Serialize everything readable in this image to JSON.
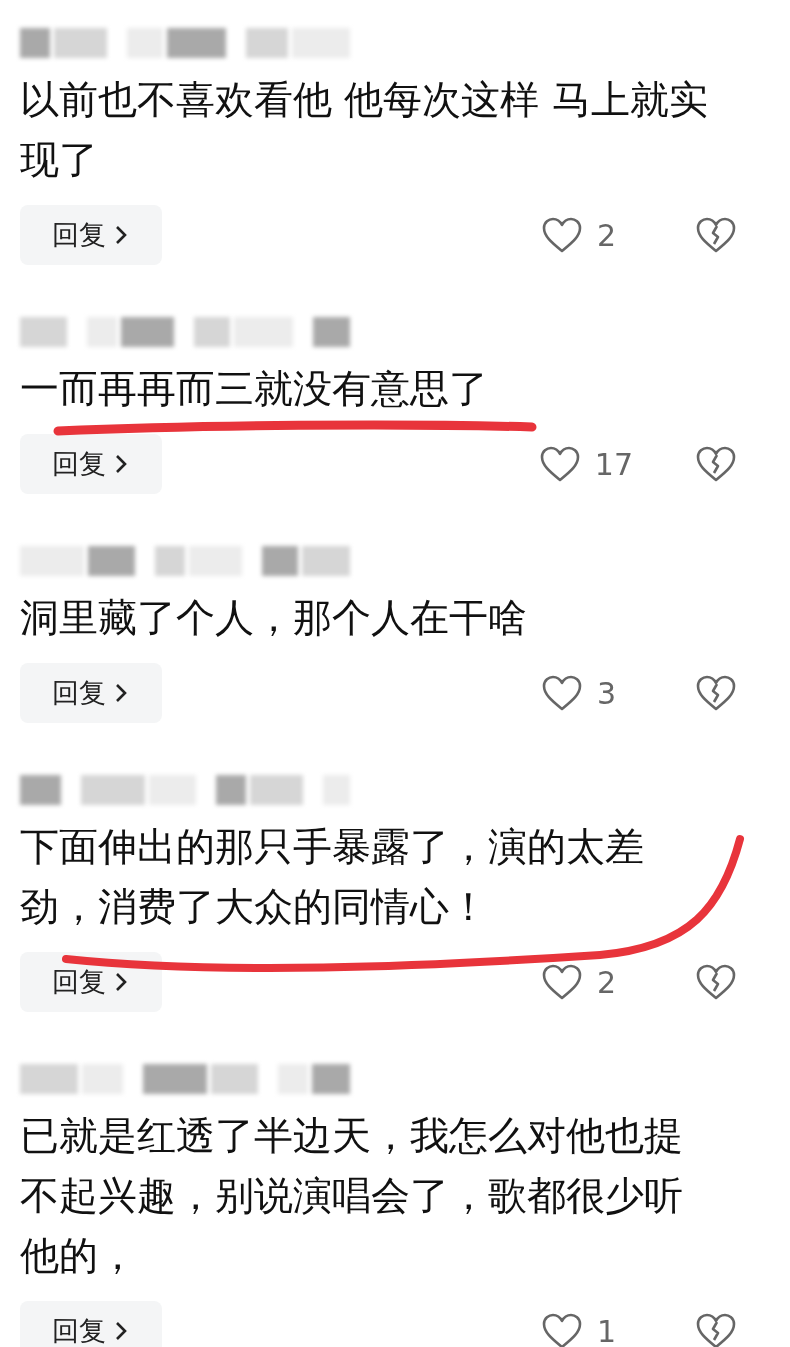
{
  "comments": [
    {
      "lines": [
        "以前也不喜欢看他 他每次这样 马上就实",
        "现了"
      ],
      "reply": "回复",
      "likes": "2",
      "underlined": false
    },
    {
      "lines": [
        "一而再再而三就没有意思了"
      ],
      "reply": "回复",
      "likes": "17",
      "underlined": true,
      "kind": "straight"
    },
    {
      "lines": [
        "洞里藏了个人，那个人在干啥"
      ],
      "reply": "回复",
      "likes": "3",
      "underlined": false
    },
    {
      "lines": [
        "下面伸出的那只手暴露了，演的太差",
        "劲，消费了大众的同情心！"
      ],
      "reply": "回复",
      "likes": "2",
      "underlined": true,
      "kind": "swoosh"
    },
    {
      "lines": [
        "已就是红透了半边天，我怎么对他也提",
        "不起兴趣，别说演唱会了，歌都很少听",
        "他的，"
      ],
      "reply": "回复",
      "likes": "1",
      "underlined": false
    }
  ]
}
